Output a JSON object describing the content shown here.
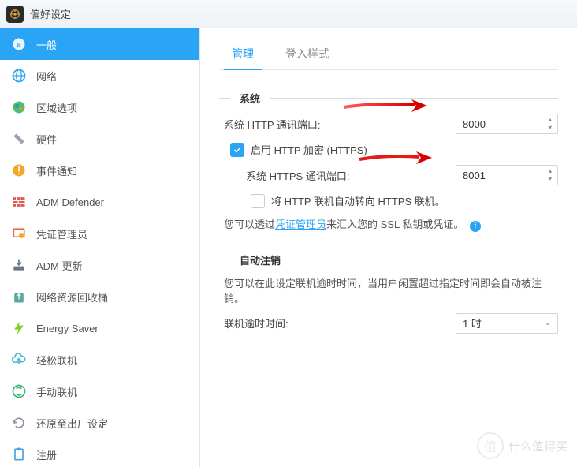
{
  "window": {
    "title": "偏好设定"
  },
  "sidebar": {
    "items": [
      {
        "label": "一般"
      },
      {
        "label": "网络"
      },
      {
        "label": "区域选项"
      },
      {
        "label": "硬件"
      },
      {
        "label": "事件通知"
      },
      {
        "label": "ADM Defender"
      },
      {
        "label": "凭证管理员"
      },
      {
        "label": "ADM 更新"
      },
      {
        "label": "网络资源回收桶"
      },
      {
        "label": "Energy Saver"
      },
      {
        "label": "轻松联机"
      },
      {
        "label": "手动联机"
      },
      {
        "label": "还原至出厂设定"
      },
      {
        "label": "注册"
      }
    ]
  },
  "tabs": {
    "manage": "管理",
    "login_style": "登入样式"
  },
  "system_section": {
    "legend": "系统",
    "http_port_label": "系统 HTTP 通讯端口:",
    "http_port_value": "8000",
    "enable_https_label": "启用 HTTP 加密 (HTTPS)",
    "enable_https_checked": true,
    "https_port_label": "系统 HTTPS 通讯端口:",
    "https_port_value": "8001",
    "redirect_label": "将 HTTP 联机自动转向 HTTPS 联机。",
    "redirect_checked": false,
    "ssl_prefix": "您可以透过",
    "ssl_link": "凭证管理员",
    "ssl_suffix": "来汇入您的 SSL 私钥或凭证。"
  },
  "logout_section": {
    "legend": "自动注销",
    "hint": "您可以在此设定联机逾时时间，当用户闲置超过指定时间即会自动被注销。",
    "timeout_label": "联机逾时时间:",
    "timeout_value": "1 时"
  },
  "watermark": {
    "text": "什么值得买"
  },
  "colors": {
    "accent": "#2aa4f4",
    "arrow": "#ff0000"
  }
}
